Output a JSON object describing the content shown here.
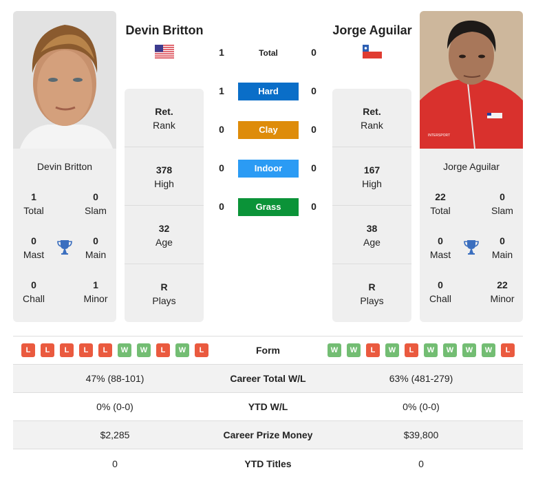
{
  "colors": {
    "hard": "#0a6ec8",
    "clay": "#de8c0a",
    "indoor": "#2b9bf4",
    "grass": "#0b9338",
    "win": "#73bd73",
    "loss": "#ea5a3f",
    "trophy": "#3b6fbf"
  },
  "players": {
    "left": {
      "name": "Devin Britton",
      "country_flag": "usa-flag",
      "photo": "player-photo-devin-britton",
      "titles": {
        "total": {
          "value": "1",
          "label": "Total"
        },
        "slam": {
          "value": "0",
          "label": "Slam"
        },
        "mast": {
          "value": "0",
          "label": "Mast"
        },
        "main": {
          "value": "0",
          "label": "Main"
        },
        "chall": {
          "value": "0",
          "label": "Chall"
        },
        "minor": {
          "value": "1",
          "label": "Minor"
        }
      },
      "info": [
        {
          "value": "Ret.",
          "label": "Rank"
        },
        {
          "value": "378",
          "label": "High"
        },
        {
          "value": "32",
          "label": "Age"
        },
        {
          "value": "R",
          "label": "Plays"
        }
      ],
      "form": [
        "L",
        "L",
        "L",
        "L",
        "L",
        "W",
        "W",
        "L",
        "W",
        "L"
      ],
      "career_wl": "47% (88-101)",
      "ytd_wl": "0% (0-0)",
      "prize_money": "$2,285",
      "ytd_titles": "0"
    },
    "right": {
      "name": "Jorge Aguilar",
      "country_flag": "chile-flag",
      "photo": "player-photo-jorge-aguilar",
      "titles": {
        "total": {
          "value": "22",
          "label": "Total"
        },
        "slam": {
          "value": "0",
          "label": "Slam"
        },
        "mast": {
          "value": "0",
          "label": "Mast"
        },
        "main": {
          "value": "0",
          "label": "Main"
        },
        "chall": {
          "value": "0",
          "label": "Chall"
        },
        "minor": {
          "value": "22",
          "label": "Minor"
        }
      },
      "info": [
        {
          "value": "Ret.",
          "label": "Rank"
        },
        {
          "value": "167",
          "label": "High"
        },
        {
          "value": "38",
          "label": "Age"
        },
        {
          "value": "R",
          "label": "Plays"
        }
      ],
      "form": [
        "W",
        "W",
        "L",
        "W",
        "L",
        "W",
        "W",
        "W",
        "W",
        "L"
      ],
      "career_wl": "63% (481-279)",
      "ytd_wl": "0% (0-0)",
      "prize_money": "$39,800",
      "ytd_titles": "0"
    }
  },
  "h2h": [
    {
      "label": "Total",
      "left": "1",
      "right": "0"
    },
    {
      "label": "Hard",
      "left": "1",
      "right": "0"
    },
    {
      "label": "Clay",
      "left": "0",
      "right": "0"
    },
    {
      "label": "Indoor",
      "left": "0",
      "right": "0"
    },
    {
      "label": "Grass",
      "left": "0",
      "right": "0"
    }
  ],
  "stats_labels": {
    "form": "Form",
    "career_wl": "Career Total W/L",
    "ytd_wl": "YTD W/L",
    "prize_money": "Career Prize Money",
    "ytd_titles": "YTD Titles"
  }
}
